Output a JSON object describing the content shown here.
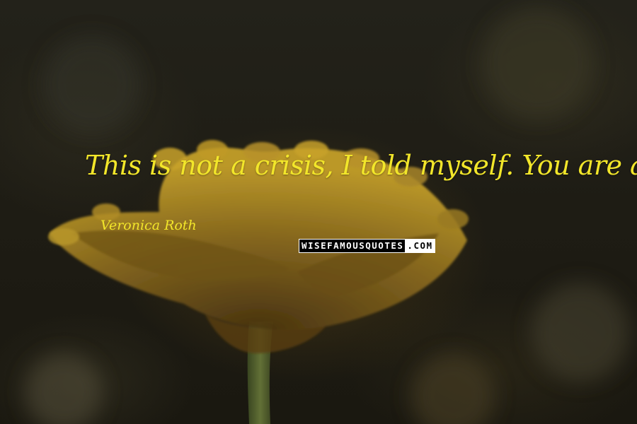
{
  "quote": {
    "text": "This is not a crisis, I told myself. You are alive.",
    "author": "Veronica Roth"
  },
  "watermark": {
    "main": "WISEFAMOUSQUOTES",
    "suffix": ".COM"
  },
  "colors": {
    "quote_text": "#f2e62a",
    "background": "#1d1a12",
    "petal": "#8a6a1e",
    "petal_highlight": "#c8a22a"
  }
}
